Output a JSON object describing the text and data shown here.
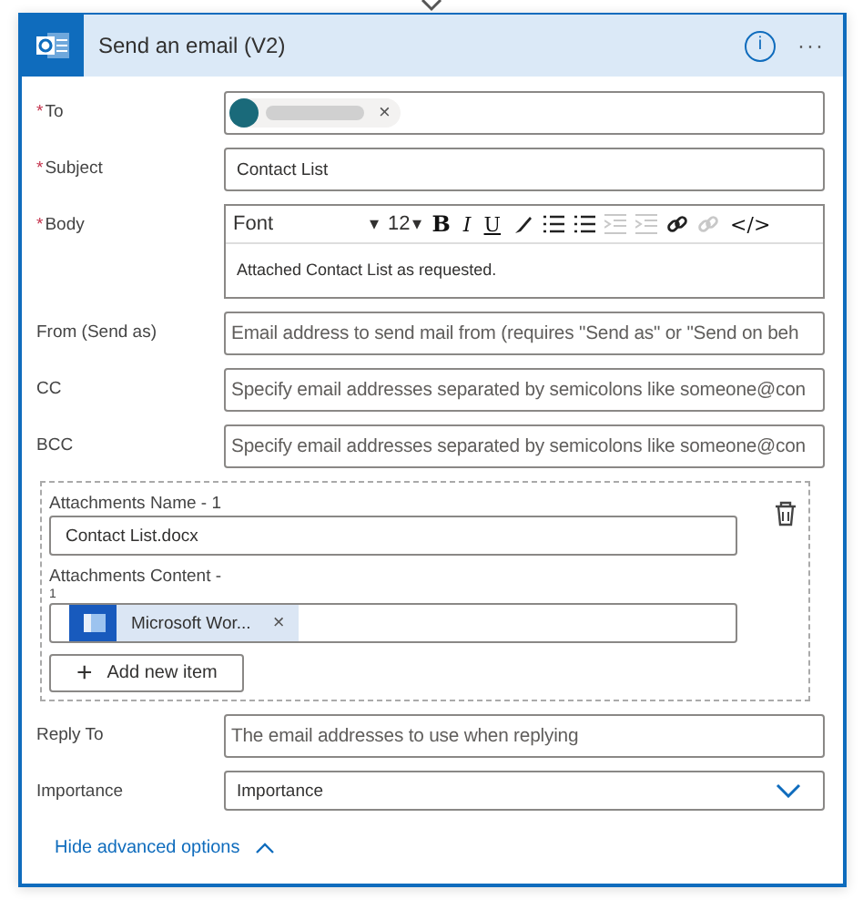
{
  "header": {
    "title": "Send an email (V2)",
    "info": "i",
    "more": "···"
  },
  "to": {
    "label": "To",
    "required": true,
    "required_mark": "*",
    "token_remove": "×"
  },
  "subject": {
    "label": "Subject",
    "required": true,
    "required_mark": "*",
    "value": "Contact List"
  },
  "body": {
    "label": "Body",
    "required": true,
    "required_mark": "*",
    "font": "Font",
    "font_caret": "▾",
    "size": "12",
    "size_caret": "▾",
    "toolbar": [
      {
        "kind": "bold",
        "text": "B",
        "disabled": false
      },
      {
        "kind": "italic",
        "text": "I",
        "disabled": false
      },
      {
        "kind": "underline",
        "text": "U",
        "disabled": false
      },
      {
        "kind": "pen",
        "disabled": false
      },
      {
        "kind": "bullets",
        "disabled": false
      },
      {
        "kind": "numbers",
        "disabled": false
      },
      {
        "kind": "outdent",
        "disabled": true
      },
      {
        "kind": "indent",
        "disabled": true
      },
      {
        "kind": "link",
        "disabled": false
      },
      {
        "kind": "unlink",
        "disabled": true
      },
      {
        "kind": "code",
        "text": "</>",
        "disabled": false
      }
    ],
    "value": "Attached Contact List as requested."
  },
  "fields": [
    {
      "label": "From (Send as)",
      "placeholder": "Email address to send mail from (requires \"Send as\" or \"Send on beh"
    },
    {
      "label": "CC",
      "placeholder": "Specify email addresses separated by semicolons like someone@con"
    },
    {
      "label": "BCC",
      "placeholder": "Specify email addresses separated by semicolons like someone@con"
    }
  ],
  "attachments": {
    "name_label": "Attachments Name - 1",
    "name_value": "Contact List.docx",
    "content_label": "Attachments Content -",
    "content_index": "1",
    "token": "Microsoft Wor...",
    "token_remove": "×",
    "add": "+",
    "add_label": "Add new item"
  },
  "reply_to": {
    "label": "Reply To",
    "placeholder": "The email addresses to use when replying"
  },
  "importance": {
    "label": "Importance",
    "value": "Importance"
  },
  "hide_link": "Hide advanced options"
}
